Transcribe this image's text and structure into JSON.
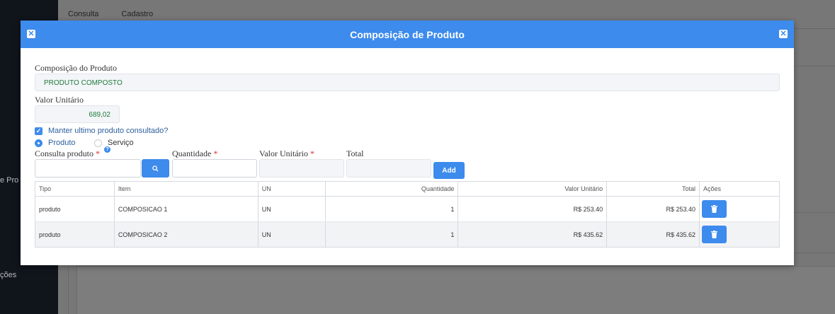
{
  "background": {
    "sidebar_text_1": "e Pro",
    "sidebar_text_2": "ções",
    "tab_consulta": "Consulta",
    "tab_cadastro": "Cadastro"
  },
  "modal": {
    "title": "Composição de Produto",
    "composicao_label": "Composição do Produto",
    "composicao_value": "PRODUTO COMPOSTO",
    "valor_unitario_label": "Valor Unitário",
    "valor_unitario_value": "689,02",
    "manter_label": "Manter ultimo produto consultado?",
    "radio_produto": "Produto",
    "radio_servico": "Serviço",
    "consulta_label": "Consulta produto",
    "quantidade_label": "Quantidade",
    "valor_unit_label": "Valor Unitário",
    "total_label": "Total",
    "required_mark": "*",
    "help_glyph": "?",
    "add_label": "Add"
  },
  "table": {
    "headers": [
      "Tipo",
      "Item",
      "UN",
      "Quantidade",
      "Valor Unitário",
      "Total",
      "Ações"
    ],
    "rows": [
      {
        "tipo": "produto",
        "item": "COMPOSICAO 1",
        "un": "UN",
        "quantidade": "1",
        "valor": "R$ 253.40",
        "total": "R$ 253.40"
      },
      {
        "tipo": "produto",
        "item": "COMPOSICAO 2",
        "un": "UN",
        "quantidade": "1",
        "valor": "R$ 435.62",
        "total": "R$ 435.62"
      }
    ]
  },
  "colors": {
    "accent": "#3d8bec",
    "value_green": "#1f7a3b"
  },
  "icons": [
    "close-icon",
    "search-icon",
    "trash-icon",
    "help-icon",
    "check-icon"
  ]
}
